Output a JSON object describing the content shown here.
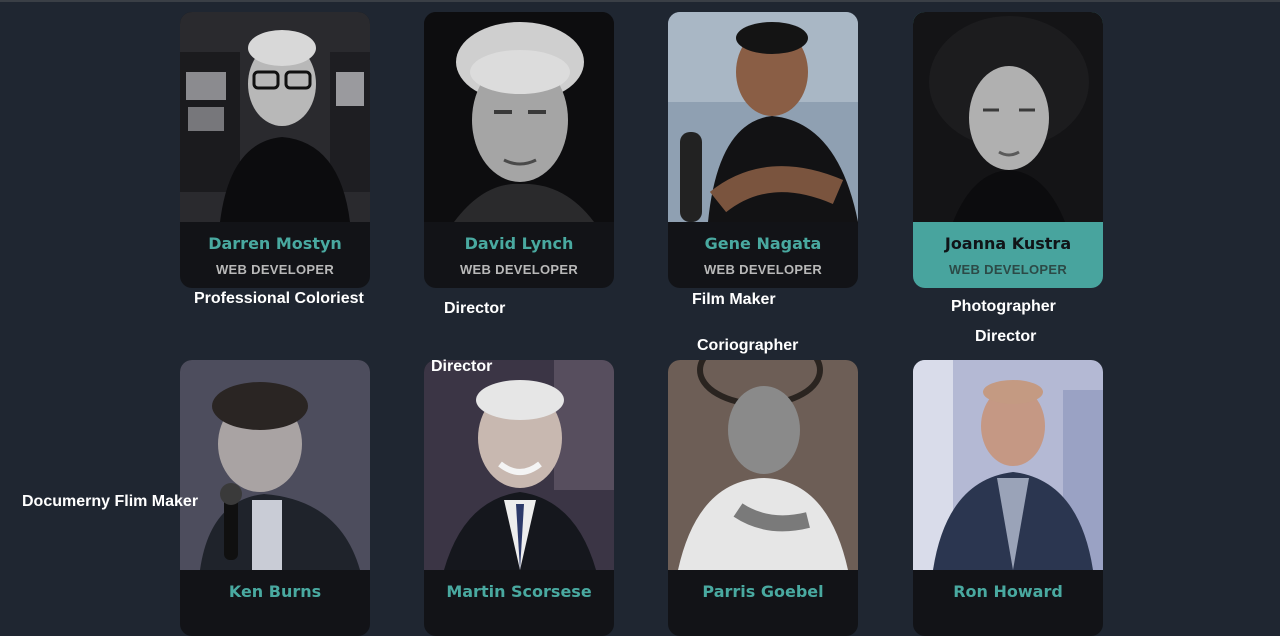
{
  "team": [
    {
      "name": "Darren Mostyn",
      "role": "WEB DEVELOPER",
      "photo": "portrait-glasses-man"
    },
    {
      "name": "David Lynch",
      "role": "WEB DEVELOPER",
      "photo": "portrait-grey-hair-man"
    },
    {
      "name": "Gene Nagata",
      "role": "WEB DEVELOPER",
      "photo": "portrait-man-microphone"
    },
    {
      "name": "Joanna Kustra",
      "role": "WEB DEVELOPER",
      "photo": "portrait-woman-hat"
    },
    {
      "name": "Ken Burns",
      "role": "",
      "photo": "portrait-man-speaking-mic"
    },
    {
      "name": "Martin Scorsese",
      "role": "",
      "photo": "portrait-smiling-man-tie"
    },
    {
      "name": "Parris Goebel",
      "role": "",
      "photo": "portrait-woman-white-shirt"
    },
    {
      "name": "Ron Howard",
      "role": "",
      "photo": "portrait-man-suit"
    }
  ],
  "captions": {
    "c1": "Professional Coloriest",
    "c2": "Director",
    "c3": "Film Maker",
    "c4": "Photographer",
    "c5": "Director",
    "c6": "Coriographer",
    "c7": "Director",
    "c8": "Documerny Flim Maker"
  },
  "colors": {
    "background": "#1f2631",
    "accent": "#48a49e",
    "card": "#121317"
  }
}
